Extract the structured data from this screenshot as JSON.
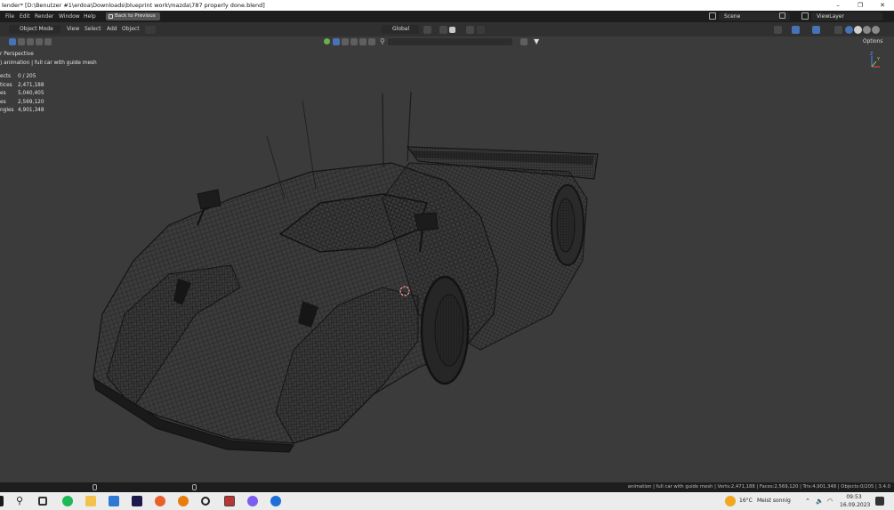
{
  "window": {
    "title": "lender* [D:\\Benutzer #1\\erdoa\\Downloads\\blueprint work\\mazda\\787 properly done.blend]",
    "minimize": "–",
    "maximize": "❐",
    "close": "✕"
  },
  "menubar": {
    "items": [
      "File",
      "Edit",
      "Render",
      "Window",
      "Help"
    ],
    "back_button": "Back to Previous",
    "scene_label": "Scene",
    "viewlayer_label": "ViewLayer"
  },
  "header": {
    "mode": "Object Mode",
    "menus": [
      "View",
      "Select",
      "Add",
      "Object"
    ],
    "transform_orientation": "Global",
    "options_label": "Options"
  },
  "viewport": {
    "view_name": "r Perspective",
    "collection_info": ") animation | full car with guide mesh",
    "stats": [
      {
        "key": "ects",
        "value": "0 / 205"
      },
      {
        "key": "tices",
        "value": "2,471,188"
      },
      {
        "key": "es",
        "value": "5,040,405"
      },
      {
        "key": "es",
        "value": "2,569,120"
      },
      {
        "key": "ngles",
        "value": "4,901,348"
      }
    ],
    "gizmo_axes": {
      "z": "Z",
      "y": "Y"
    }
  },
  "statusbar": {
    "text": "animation | full car with guide mesh | Verts:2,471,188 | Faces:2,569,120 | Tris:4,901,348 | Objects:0/205 | 3.4.0"
  },
  "taskbar": {
    "weather_temp": "16°C",
    "weather_text": "Meist sonnig",
    "time": "09:53",
    "date": "16.09.2023"
  },
  "colors": {
    "viewport_bg": "#3b3b3b",
    "wire": "#1a1a1a",
    "header_bg": "#303030",
    "menubar_bg": "#1d1d1d",
    "accent_blue": "#4772b3"
  },
  "icons": [
    "windows-start-icon",
    "search-icon",
    "task-view-icon",
    "spotify-icon",
    "file-explorer-icon",
    "mail-icon",
    "premiere-icon",
    "firefox-icon",
    "blender-icon",
    "search-app-icon",
    "image-app-icon",
    "messenger-icon",
    "k-app-icon"
  ]
}
